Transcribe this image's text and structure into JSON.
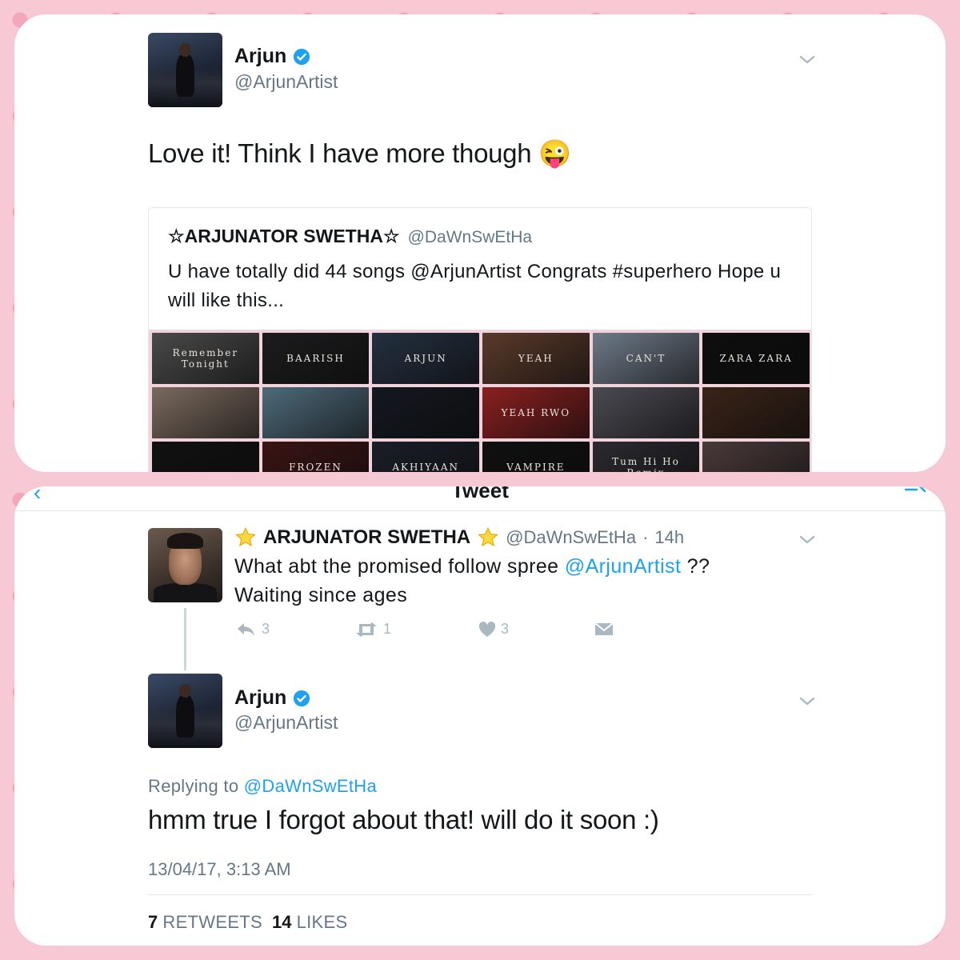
{
  "top_tweet": {
    "author_name": "Arjun",
    "author_handle": "@ArjunArtist",
    "text": "Love it! Think I have more though 😜",
    "quoted": {
      "name": "☆ARJUNATOR SWETHA☆",
      "handle": "@DaWnSwEtHa",
      "text": "U have totally did 44 songs @ArjunArtist Congrats #superhero Hope u will like this...",
      "thumbnails": [
        {
          "label": "Remember Tonight",
          "color": "#4a4a4a"
        },
        {
          "label": "BAARISH",
          "color": "#1c1c1e"
        },
        {
          "label": "ARJUN",
          "color": "#243040"
        },
        {
          "label": "YEAH",
          "color": "#5a3a2a"
        },
        {
          "label": "CAN'T",
          "color": "#6e7a88"
        },
        {
          "label": "ZARA ZARA",
          "color": "#0e0e0e"
        },
        {
          "label": "",
          "color": "#7a6a5e"
        },
        {
          "label": "",
          "color": "#4e6a7a"
        },
        {
          "label": "",
          "color": "#141820"
        },
        {
          "label": "YEAH RWO",
          "color": "#8a2020"
        },
        {
          "label": "",
          "color": "#4a4a52"
        },
        {
          "label": "",
          "color": "#3a2418"
        },
        {
          "label": "",
          "color": "#111111"
        },
        {
          "label": "FROZEN",
          "color": "#3a1414"
        },
        {
          "label": "AKHIYAAN",
          "color": "#1a1e28"
        },
        {
          "label": "VAMPIRE",
          "color": "#101010"
        },
        {
          "label": "Tum Hi Ho Remix",
          "color": "#2a2a30"
        },
        {
          "label": "",
          "color": "#4a3a3a"
        }
      ]
    }
  },
  "nav": {
    "title": "Tweet",
    "back_icon": "chevron-left-icon",
    "compose_icon": "compose-icon"
  },
  "reply_tweet": {
    "name": "ARJUNATOR SWETHA",
    "handle": "@DaWnSwEtHa",
    "sep": "·",
    "time": "14h",
    "text_pre": "What abt the promised follow spree ",
    "mention": "@ArjunArtist",
    "text_post": " ??",
    "text_line2": "Waiting since ages",
    "actions": {
      "reply_count": "3",
      "retweet_count": "1",
      "like_count": "3"
    }
  },
  "main_tweet": {
    "author_name": "Arjun",
    "author_handle": "@ArjunArtist",
    "replying_prefix": "Replying to ",
    "replying_to": "@DaWnSwEtHa",
    "text": "hmm true I forgot about that! will do it soon :)",
    "timestamp": "13/04/17, 3:13 AM",
    "retweets_count": "7",
    "retweets_label": "RETWEETS",
    "likes_count": "14",
    "likes_label": "LIKES"
  },
  "colors": {
    "accent": "#1da1f2",
    "muted": "#657786",
    "icon_gray": "#aab8c2",
    "background_pink": "#f7c9d4"
  }
}
